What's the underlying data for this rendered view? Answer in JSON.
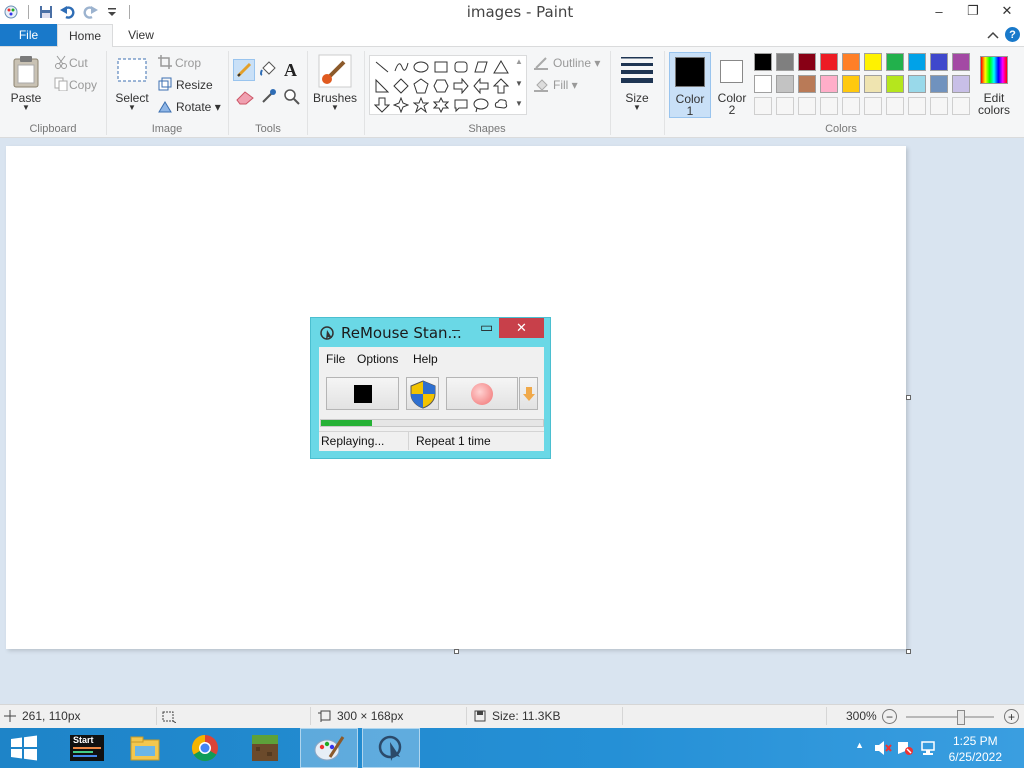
{
  "window": {
    "title": "images - Paint",
    "minimize": "–",
    "restore": "❐",
    "close": "✕"
  },
  "tabs": {
    "file": "File",
    "home": "Home",
    "view": "View"
  },
  "ribbon": {
    "clipboard": {
      "paste": "Paste",
      "cut": "Cut",
      "copy": "Copy",
      "label": "Clipboard"
    },
    "image": {
      "select": "Select",
      "crop": "Crop",
      "resize": "Resize",
      "rotate": "Rotate",
      "label": "Image"
    },
    "tools": {
      "label": "Tools",
      "text_tool": "A"
    },
    "brushes": {
      "label": "Brushes"
    },
    "shapes": {
      "outline": "Outline",
      "fill": "Fill",
      "label": "Shapes"
    },
    "size": {
      "label": "Size"
    },
    "colors": {
      "color1": "Color",
      "color1_num": "1",
      "color2": "Color",
      "color2_num": "2",
      "edit": "Edit",
      "edit2": "colors",
      "label": "Colors",
      "color1_value": "#000000",
      "color2_value": "#ffffff",
      "palette_row1": [
        "#000000",
        "#7f7f7f",
        "#880015",
        "#ed1c24",
        "#ff7f27",
        "#fff200",
        "#22b14c",
        "#00a2e8",
        "#3f48cc",
        "#a349a4"
      ],
      "palette_row2": [
        "#ffffff",
        "#c3c3c3",
        "#b97a57",
        "#ffaec9",
        "#ffc90e",
        "#efe4b0",
        "#b5e61d",
        "#99d9ea",
        "#7092be",
        "#c8bfe7"
      ]
    }
  },
  "remouse": {
    "title": "ReMouse Stan...",
    "minimize": "–",
    "maximize": "▭",
    "close": "✕",
    "menu": [
      "File",
      "Options",
      "Help"
    ],
    "progress_fraction": 0.23,
    "status": "Replaying...",
    "repeat": "Repeat 1 time"
  },
  "statusbar": {
    "cursor_pos": "261, 110px",
    "image_size": "300 × 168px",
    "file_size": "Size: 11.3KB",
    "zoom": "300%",
    "zoom_fraction": 0.62
  },
  "taskbar": {
    "start_app_label": "Start",
    "time": "1:25 PM",
    "date": "6/25/2022"
  }
}
